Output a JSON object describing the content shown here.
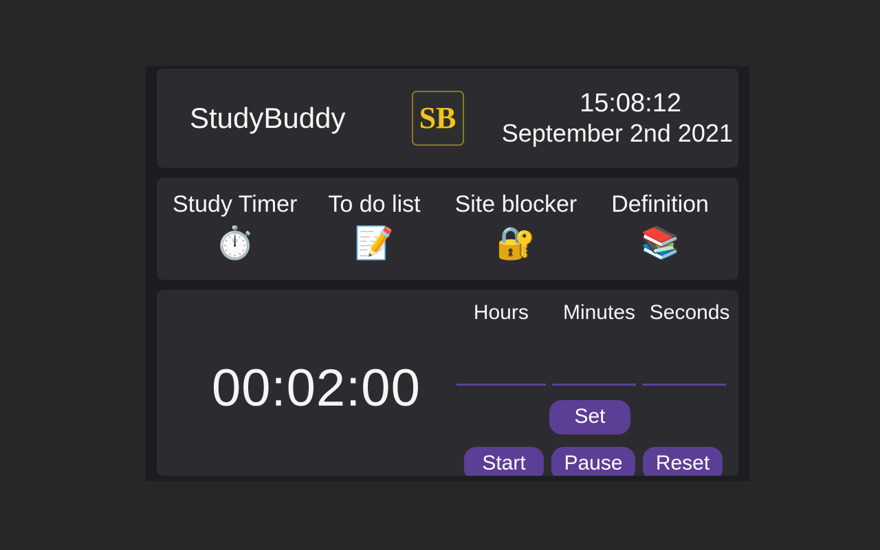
{
  "theme": {
    "page_bg": "#272729",
    "container_bg": "#1d1d21",
    "panel_bg": "#2c2c30",
    "text_color": "#f7f7f7",
    "accent_purple": "#5b3f96",
    "input_underline": "#5f3fa0",
    "logo_gold": "#f0c420",
    "logo_border": "#8a7a22"
  },
  "header": {
    "app_title": "StudyBuddy",
    "logo_text": "SB",
    "logo_icon_name": "studybuddy-logo-icon",
    "clock_time": "15:08:12",
    "clock_date": "September 2nd 2021"
  },
  "nav": {
    "items": [
      {
        "label": "Study Timer",
        "icon": "⏱️",
        "icon_name": "stopwatch-icon",
        "active": true
      },
      {
        "label": "To do list",
        "icon": "📝",
        "icon_name": "memo-pencil-icon",
        "active": false
      },
      {
        "label": "Site blocker",
        "icon": "🔐",
        "icon_name": "lock-with-key-icon",
        "active": false
      },
      {
        "label": "Definition",
        "icon": "📚",
        "icon_name": "books-icon",
        "active": false
      }
    ]
  },
  "timer": {
    "display": "00:02:00",
    "fields": [
      {
        "label": "Hours",
        "value": "",
        "placeholder": ""
      },
      {
        "label": "Minutes",
        "value": "",
        "placeholder": ""
      },
      {
        "label": "Seconds",
        "value": "",
        "placeholder": ""
      }
    ],
    "buttons": {
      "set": "Set",
      "start": "Start",
      "pause": "Pause",
      "reset": "Reset"
    }
  }
}
